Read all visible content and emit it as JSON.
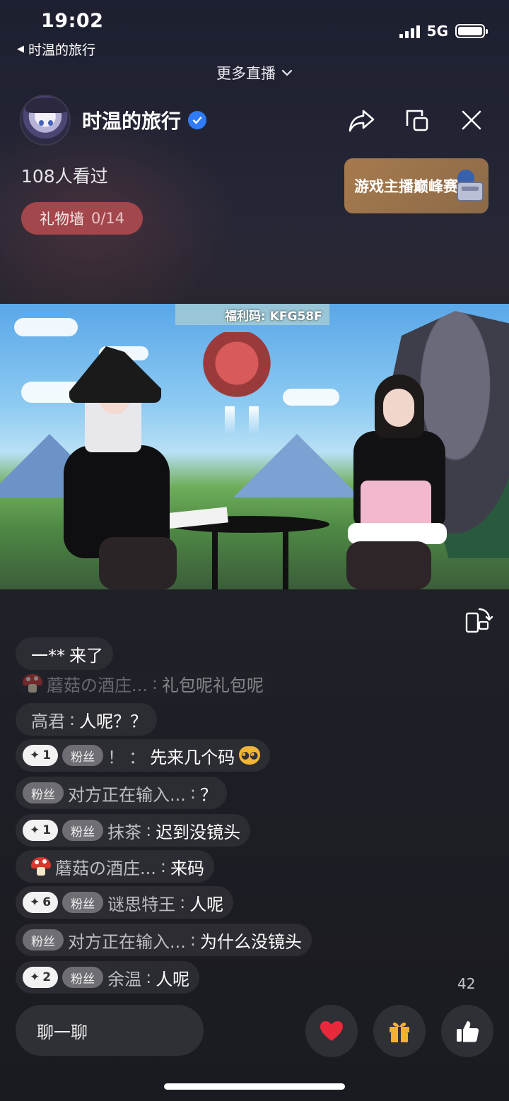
{
  "status_bar": {
    "time": "19:02",
    "back_app": "时温的旅行",
    "network": "5G",
    "battery_level": 1.0,
    "icons": [
      "signal-icon",
      "battery-icon"
    ]
  },
  "top_nav": {
    "more_live": "更多直播"
  },
  "anchor": {
    "name": "时温的旅行",
    "verified": true,
    "viewers": "108人看过",
    "gift_wall_label": "礼物墙",
    "gift_wall_count": "0/14",
    "promo_banner": "游戏主播巅峰赛",
    "actions": [
      "share-icon",
      "window-icon",
      "close-icon"
    ]
  },
  "video": {
    "overlay_text": "福利码: KFG58F"
  },
  "comments": [
    {
      "nick": "一**",
      "msg": "来了",
      "type": "enter"
    },
    {
      "nick": "蘑菇の酒庄...",
      "msg": "礼包呢礼包呢",
      "sep": ": ",
      "faded": true
    },
    {
      "nick": "高君",
      "msg": "人呢？？",
      "sep": ": "
    },
    {
      "level": "1",
      "fan": "粉丝",
      "nick": "！",
      "msg": "先来几个码",
      "sep": "："
    },
    {
      "fan": "粉丝",
      "nick": "对方正在输入...",
      "msg": "？",
      "sep": ": "
    },
    {
      "level": "1",
      "fan": "粉丝",
      "nick": "抹茶",
      "msg": "迟到没镜头",
      "sep": ": "
    },
    {
      "nick": "蘑菇の酒庄...",
      "msg": "来码",
      "sep": ": "
    },
    {
      "level": "6",
      "fan": "粉丝",
      "nick": "谜思特王",
      "msg": "人呢",
      "sep": ": "
    },
    {
      "fan": "粉丝",
      "nick": "对方正在输入...",
      "msg": "为什么没镜头",
      "sep": ": "
    },
    {
      "level": "2",
      "fan": "粉丝",
      "nick": "余温",
      "msg": "人呢",
      "sep": ": "
    }
  ],
  "likes_count": "42",
  "bottom_bar": {
    "chat_placeholder": "聊一聊",
    "buttons": [
      "heart-icon",
      "gift-icon",
      "thumbs-up-icon"
    ]
  },
  "colors": {
    "gift_wall_bg": "#a3474c",
    "verified_blue": "#2f7cf6",
    "heart_red": "#e8293b",
    "gift_gold": "#f0b330"
  }
}
